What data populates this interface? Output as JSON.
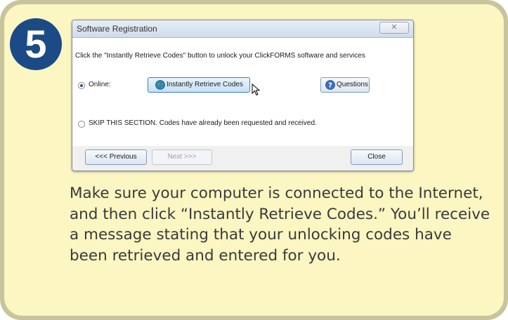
{
  "step": {
    "number": "5"
  },
  "dialog": {
    "title": "Software Registration",
    "close_label": "✕",
    "instruction": "Click the \"Instantly Retrieve Codes\" button to unlock your ClickFORMS software and services",
    "online_label": "Online:",
    "online_selected": true,
    "retrieve_button_label": "Instantly Retrieve Codes",
    "questions_button_label": "Questions",
    "skip_label": "SKIP THIS SECTION. Codes have already been requested and received.",
    "skip_selected": false,
    "previous_button_label": "<<< Previous",
    "next_button_label": "Next >>>",
    "close_button_label": "Close"
  },
  "caption": {
    "text": "Make sure your computer is connected to the Internet, and then click “Instantly Retrieve Codes.” You’ll receive a message stating that your unlocking codes have been retrieved and entered for you."
  },
  "colors": {
    "card_background": "#fbf6c2",
    "card_border": "#c8c49c",
    "badge": "#1b4a86"
  },
  "icons": {
    "retrieve": "globe-icon",
    "questions": "question-icon",
    "pointer": "cursor-icon"
  }
}
